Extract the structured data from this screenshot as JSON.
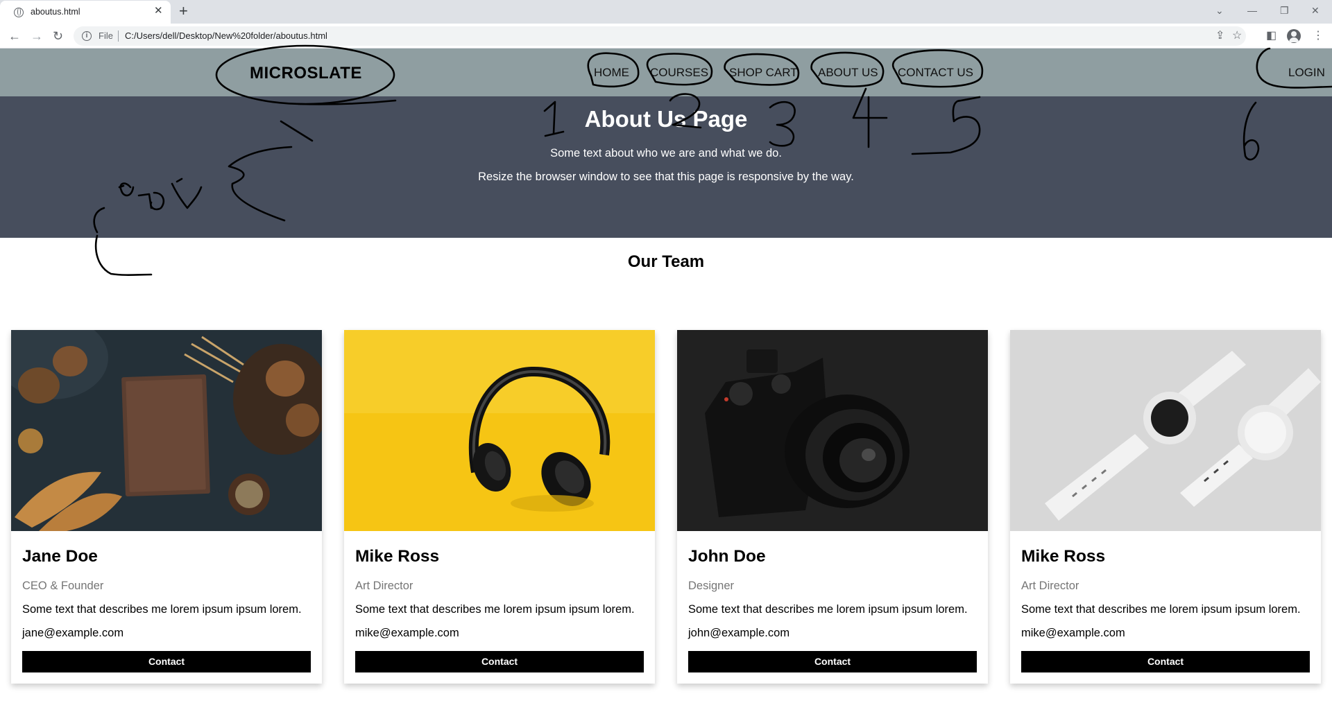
{
  "browser": {
    "tab_title": "aboutus.html",
    "tab_close": "✕",
    "new_tab": "+",
    "omnibox_scheme": "File",
    "url": "C:/Users/dell/Desktop/New%20folder/aboutus.html",
    "icons": [
      "globe-icon",
      "back-arrow-icon",
      "forward-arrow-icon",
      "reload-icon",
      "info-icon",
      "share-icon",
      "star-icon",
      "side-panel-icon",
      "profile-icon",
      "kebab-menu-icon",
      "minimize-icon",
      "restore-icon",
      "close-icon",
      "tab-list-icon"
    ]
  },
  "site": {
    "brand": "MICROSLATE",
    "nav": [
      "HOME",
      "COURSES",
      "SHOP CART",
      "ABOUT US",
      "CONTACT US"
    ],
    "login": "LOGIN",
    "nav_bg": "#8f9ea1"
  },
  "hero": {
    "title": "About Us Page",
    "line1": "Some text about who we are and what we do.",
    "line2": "Resize the browser window to see that this page is responsive by the way.",
    "bg": "#474e5d"
  },
  "team": {
    "title": "Our Team",
    "members": [
      {
        "name": "Jane Doe",
        "role": "CEO & Founder",
        "desc": "Some text that describes me lorem ipsum ipsum lorem.",
        "email": "jane@example.com",
        "button": "Contact",
        "image": "bread-book-photo"
      },
      {
        "name": "Mike Ross",
        "role": "Art Director",
        "desc": "Some text that describes me lorem ipsum ipsum lorem.",
        "email": "mike@example.com",
        "button": "Contact",
        "image": "headphones-photo"
      },
      {
        "name": "John Doe",
        "role": "Designer",
        "desc": "Some text that describes me lorem ipsum ipsum lorem.",
        "email": "john@example.com",
        "button": "Contact",
        "image": "camera-photo"
      },
      {
        "name": "Mike Ross",
        "role": "Art Director",
        "desc": "Some text that describes me lorem ipsum ipsum lorem.",
        "email": "mike@example.com",
        "button": "Contact",
        "image": "watches-photo"
      }
    ]
  },
  "annotations": {
    "numbers": [
      "1",
      "2",
      "3",
      "4",
      "5",
      "6"
    ],
    "handwritten_arabic": "اللوجو",
    "ink_color": "#000000"
  }
}
